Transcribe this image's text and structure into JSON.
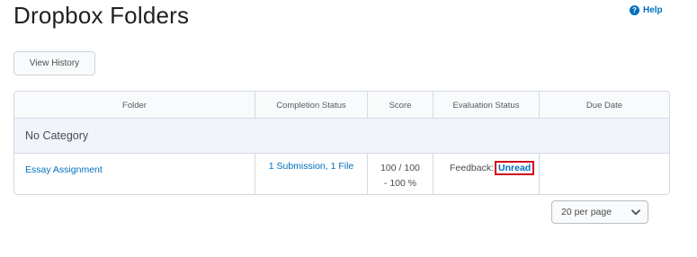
{
  "page": {
    "title": "Dropbox Folders"
  },
  "help": {
    "label": "Help",
    "icon": "help-circle-icon",
    "glyph": "?"
  },
  "toolbar": {
    "view_history_label": "View History"
  },
  "table": {
    "columns": [
      "Folder",
      "Completion Status",
      "Score",
      "Evaluation Status",
      "Due Date"
    ],
    "category": "No Category",
    "rows": [
      {
        "folder": "Essay Assignment",
        "completion": "1 Submission, 1 File",
        "score_line1": "100 / 100",
        "score_line2": "- 100 %",
        "evaluation_prefix": "Feedback:",
        "evaluation_link": "Unread",
        "due_date": ""
      }
    ]
  },
  "pagination": {
    "per_page": "20 per page",
    "icon": "chevron-down-icon"
  },
  "colors": {
    "link": "#006fbf",
    "highlight_border": "#d0021b",
    "header_bg": "#f9fafb",
    "category_bg": "#f1f5fb"
  }
}
